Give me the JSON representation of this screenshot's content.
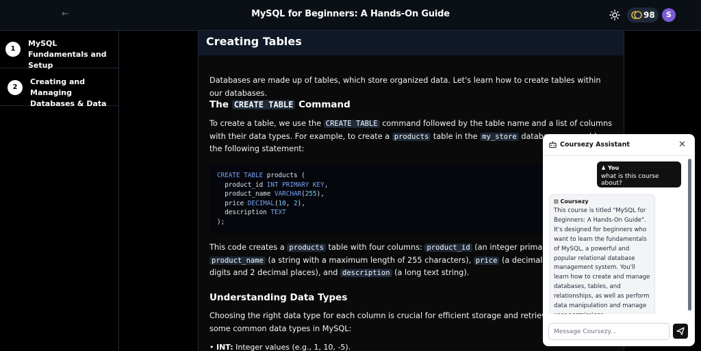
{
  "header": {
    "title": "MySQL for Beginners: A Hands-On Guide",
    "coins": "98",
    "avatar_initial": "S"
  },
  "sidebar": {
    "items": [
      {
        "number": "1",
        "label": "MySQL Fundamentals and Setup"
      },
      {
        "number": "2",
        "label": "Creating and Managing Databases & Data"
      }
    ]
  },
  "lesson": {
    "title": "Creating Tables",
    "intro": "Databases are made up of tables, which store organized data. Let's learn how to create tables within our databases.",
    "h_command_pre": "The ",
    "h_command_code": "CREATE TABLE",
    "h_command_post": " Command",
    "p2": {
      "a": "To create a table, we use the ",
      "code1": "CREATE TABLE",
      "b": " command followed by the table name and a list of columns with their data types. For example, to create a ",
      "code2": "products",
      "c": " table in the ",
      "code3": "my_store",
      "d": " database, we could use the following statement:"
    },
    "code_lines": [
      "CREATE TABLE products (",
      "  product_id INT PRIMARY KEY,",
      "  product_name VARCHAR(255),",
      "  price DECIMAL(10, 2),",
      "  description TEXT",
      ");"
    ],
    "p3": {
      "a": "This code creates a ",
      "code1": "products",
      "b": " table with four columns: ",
      "code2": "product_id",
      "c": " (an integer primary key), ",
      "code3": "product_name",
      "d": " (a string with a maximum length of 255 characters), ",
      "code4": "price",
      "e": " (a decimal number with 10 digits and 2 decimal places), and ",
      "code5": "description",
      "f": " (a long text string)."
    },
    "h_types": "Understanding Data Types",
    "p4": "Choosing the right data type for each column is crucial for efficient storage and retrieval. Here are some common data types in MySQL:",
    "bullet1_strong": "INT:",
    "bullet1_text": " Integer values (e.g., 1, 10, -5)."
  },
  "chat": {
    "title": "Coursezy Assistant",
    "user_label": "You",
    "user_message": "what is this course about?",
    "bot_label": "Coursezy",
    "bot_message": "This course is titled \"MySQL for Beginners: A Hands-On Guide\". It's designed for beginners who want to learn the fundamentals of MySQL, a powerful and popular relational database management system. You'll learn how to create and manage databases, tables, and relationships, as well as perform data manipulation and manage user permissions.",
    "input_placeholder": "Message Coursezy..."
  }
}
